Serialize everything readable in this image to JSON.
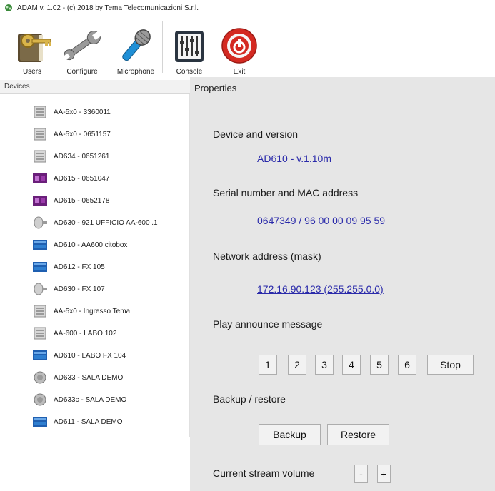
{
  "window": {
    "title": "ADAM v. 1.02 - (c) 2018 by Tema Telecomunicazioni S.r.l.",
    "app_icon": "adam-app-icon"
  },
  "toolbar": {
    "buttons": [
      {
        "label": "Users",
        "icon": "users-book-key-icon"
      },
      {
        "label": "Configure",
        "icon": "wrench-icon"
      },
      {
        "label": "Microphone",
        "icon": "microphone-icon"
      },
      {
        "label": "Console",
        "icon": "mixer-console-icon"
      },
      {
        "label": "Exit",
        "icon": "power-exit-icon"
      }
    ]
  },
  "devices": {
    "header": "Devices",
    "items": [
      {
        "label": "AA-5x0 - 3360011",
        "icon": "rack-device-icon"
      },
      {
        "label": "AA-5x0 - 0651157",
        "icon": "rack-device-icon"
      },
      {
        "label": "AD634 - 0651261",
        "icon": "rack-device-icon"
      },
      {
        "label": "AD615 - 0651047",
        "icon": "purple-panel-icon"
      },
      {
        "label": "AD615 - 0652178",
        "icon": "purple-panel-icon"
      },
      {
        "label": "AD630 - 921 UFFICIO AA-600 .1",
        "icon": "speaker-horn-icon"
      },
      {
        "label": "AD610 - AA600 citobox",
        "icon": "blue-panel-icon"
      },
      {
        "label": "AD612 - FX 105",
        "icon": "blue-panel-icon"
      },
      {
        "label": "AD630 - FX 107",
        "icon": "speaker-horn-icon"
      },
      {
        "label": "AA-5x0 - Ingresso Tema",
        "icon": "rack-device-icon"
      },
      {
        "label": "AA-600 - LABO 102",
        "icon": "rack-device-icon"
      },
      {
        "label": "AD610 - LABO FX 104",
        "icon": "blue-panel-icon"
      },
      {
        "label": "AD633 - SALA DEMO",
        "icon": "round-speaker-icon"
      },
      {
        "label": "AD633c - SALA DEMO",
        "icon": "round-speaker-icon"
      },
      {
        "label": "AD611 - SALA DEMO",
        "icon": "blue-panel-icon"
      }
    ]
  },
  "properties": {
    "title": "Properties",
    "device_version_label": "Device and version",
    "device_version_value": "AD610 - v.1.10m",
    "serial_label": "Serial number and MAC address",
    "serial_value": "0647349 / 96 00 00 09 95 59",
    "network_label": "Network address (mask)",
    "network_value": "172.16.90.123 (255.255.0.0)",
    "announce_label": "Play announce message",
    "announce_buttons": [
      "1",
      "2",
      "3",
      "4",
      "5",
      "6"
    ],
    "stop_label": "Stop",
    "backup_section_label": "Backup / restore",
    "backup_label": "Backup",
    "restore_label": "Restore",
    "volume_label": "Current stream volume",
    "volume_minus": "-",
    "volume_plus": "+"
  },
  "colors": {
    "value_text": "#2a2aaa",
    "panel_bg": "#e6e6e6",
    "exit_red": "#d42a22",
    "mic_blue": "#1f8fd6"
  }
}
